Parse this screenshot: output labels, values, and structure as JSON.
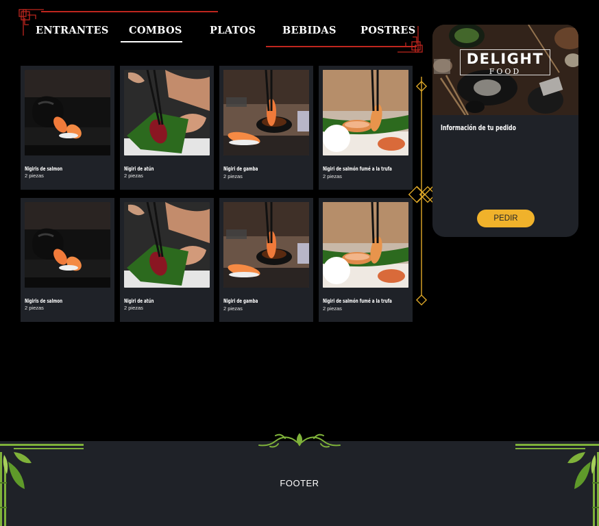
{
  "nav": {
    "tabs": [
      {
        "label": "ENTRANTES",
        "active": false
      },
      {
        "label": "COMBOS",
        "active": true
      },
      {
        "label": "PLATOS",
        "active": false
      },
      {
        "label": "BEBIDAS",
        "active": false
      },
      {
        "label": "POSTRES",
        "active": false
      }
    ]
  },
  "products": [
    {
      "name": "Nigiris de salmon",
      "qty": "2 piezas",
      "image": "salmon-nigiri-photo"
    },
    {
      "name": "Nigiri de atún",
      "qty": "2 piezas",
      "image": "tuna-nigiri-photo"
    },
    {
      "name": "Nigiri de gamba",
      "qty": "2 piezas",
      "image": "shrimp-nigiri-photo"
    },
    {
      "name": "Nigiri de salmón fumé a la trufa",
      "qty": "2 piezas",
      "image": "smoked-salmon-truffle-photo"
    },
    {
      "name": "Nigiris de salmon",
      "qty": "2 piezas",
      "image": "salmon-nigiri-photo"
    },
    {
      "name": "Nigiri de atún",
      "qty": "2 piezas",
      "image": "tuna-nigiri-photo"
    },
    {
      "name": "Nigiri de gamba",
      "qty": "2 piezas",
      "image": "shrimp-nigiri-photo"
    },
    {
      "name": "Nigiri de salmón fumé a la trufa",
      "qty": "2 piezas",
      "image": "smoked-salmon-truffle-photo"
    }
  ],
  "order": {
    "logo_title": "DELIGHT",
    "logo_sub": "FOOD",
    "title": "Información de tu pedido",
    "button_label": "PEDIR"
  },
  "footer": {
    "label": "FOOTER"
  },
  "colors": {
    "background": "#000000",
    "card": "#1f2228",
    "accent_gold": "#f0b22b",
    "accent_red": "#c0261e",
    "leaf_green": "#7fb23a"
  }
}
